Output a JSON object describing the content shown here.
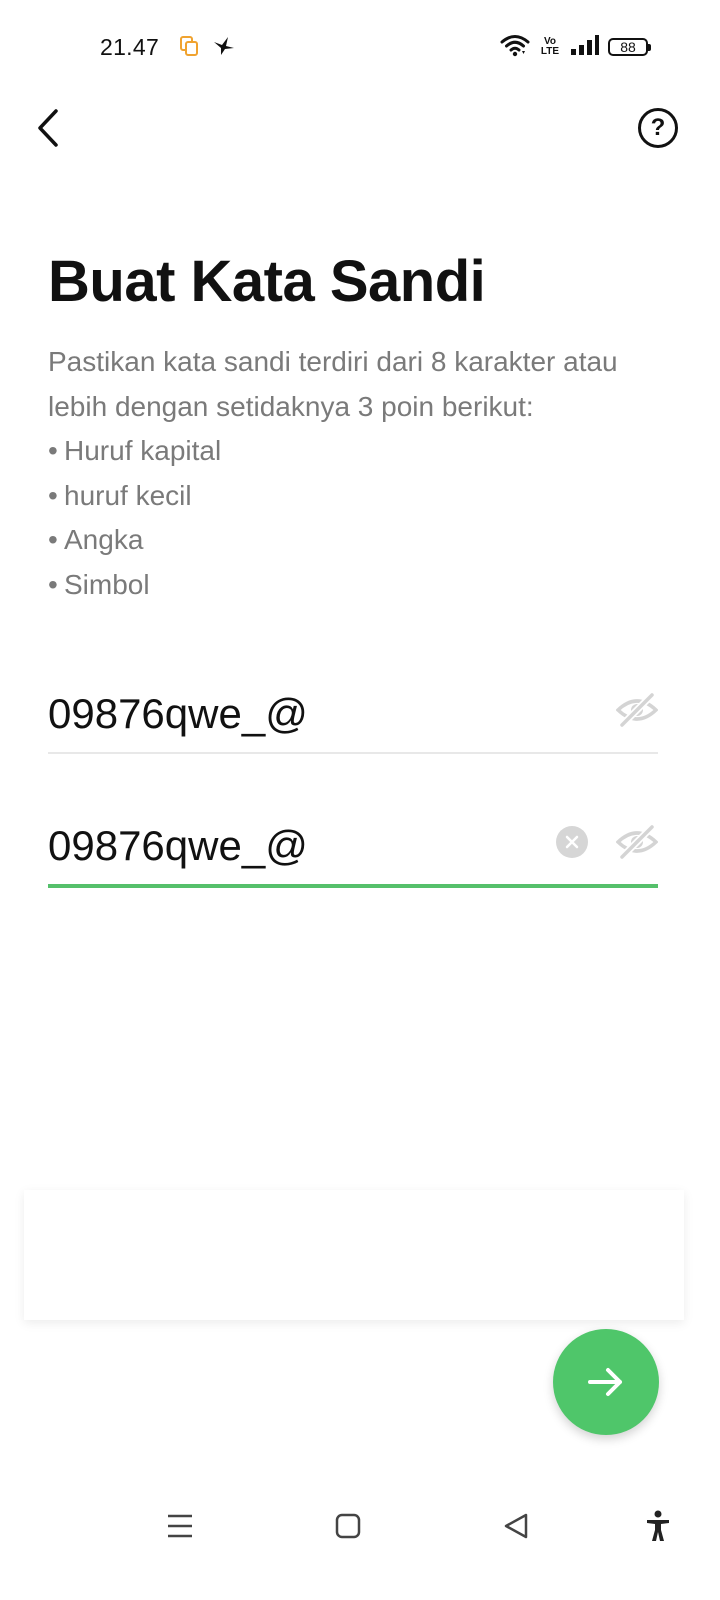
{
  "status_bar": {
    "time": "21.47",
    "volte_top": "Vo",
    "volte_bottom": "LTE",
    "battery": "88",
    "icons": [
      "copy-notification-icon",
      "bird-app-icon",
      "wifi-icon",
      "volte-icon",
      "signal-icon",
      "battery-icon"
    ]
  },
  "header": {
    "back_icon": "chevron-left-icon",
    "help_symbol": "?"
  },
  "page": {
    "title": "Buat Kata Sandi",
    "description_line1": "Pastikan kata sandi terdiri dari 8 karakter atau",
    "description_line2": "lebih dengan setidaknya 3 poin berikut:",
    "bullets": [
      "Huruf kapital",
      "huruf kecil",
      "Angka",
      "Simbol"
    ]
  },
  "form": {
    "password_value": "09876qwe_@",
    "confirm_value": "09876qwe_@"
  },
  "actions": {
    "next_icon": "arrow-right-icon"
  },
  "colors": {
    "accent": "#4fc66a",
    "focus_underline": "#55c06b",
    "muted_text": "#7a7a7a",
    "icon_gray": "#d6d6d6"
  },
  "nav_bar": {
    "icons": [
      "menu-icon",
      "home-square-icon",
      "back-triangle-icon",
      "accessibility-icon"
    ]
  }
}
